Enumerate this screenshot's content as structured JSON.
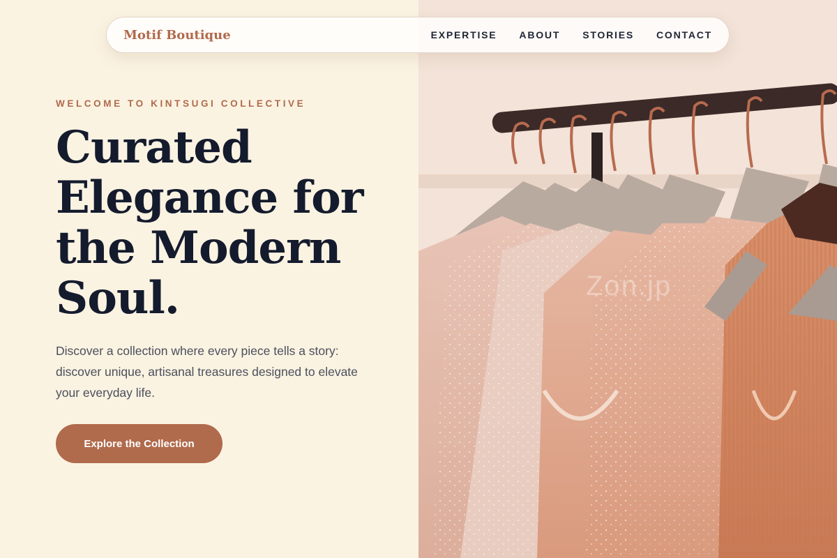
{
  "brand": {
    "name": "Motif Boutique",
    "color": "#b06a4c"
  },
  "nav": {
    "links": [
      "EXPERTISE",
      "ABOUT",
      "STORIES",
      "CONTACT"
    ]
  },
  "hero": {
    "eyebrow": "WELCOME TO KINTSUGI COLLECTIVE",
    "headline": "Curated Elegance for the Modern Soul.",
    "description": "Discover a collection where every piece tells a story: discover unique, artisanal treasures designed to elevate your everyday life.",
    "cta_label": "Explore the Collection"
  },
  "image": {
    "subject": "clothing-rack-photo",
    "watermark": "Zon.jp"
  },
  "colors": {
    "background": "#fbf3e2",
    "accent": "#b06a4c",
    "text_dark": "#141b2d",
    "text_body": "#4a4f5c"
  }
}
